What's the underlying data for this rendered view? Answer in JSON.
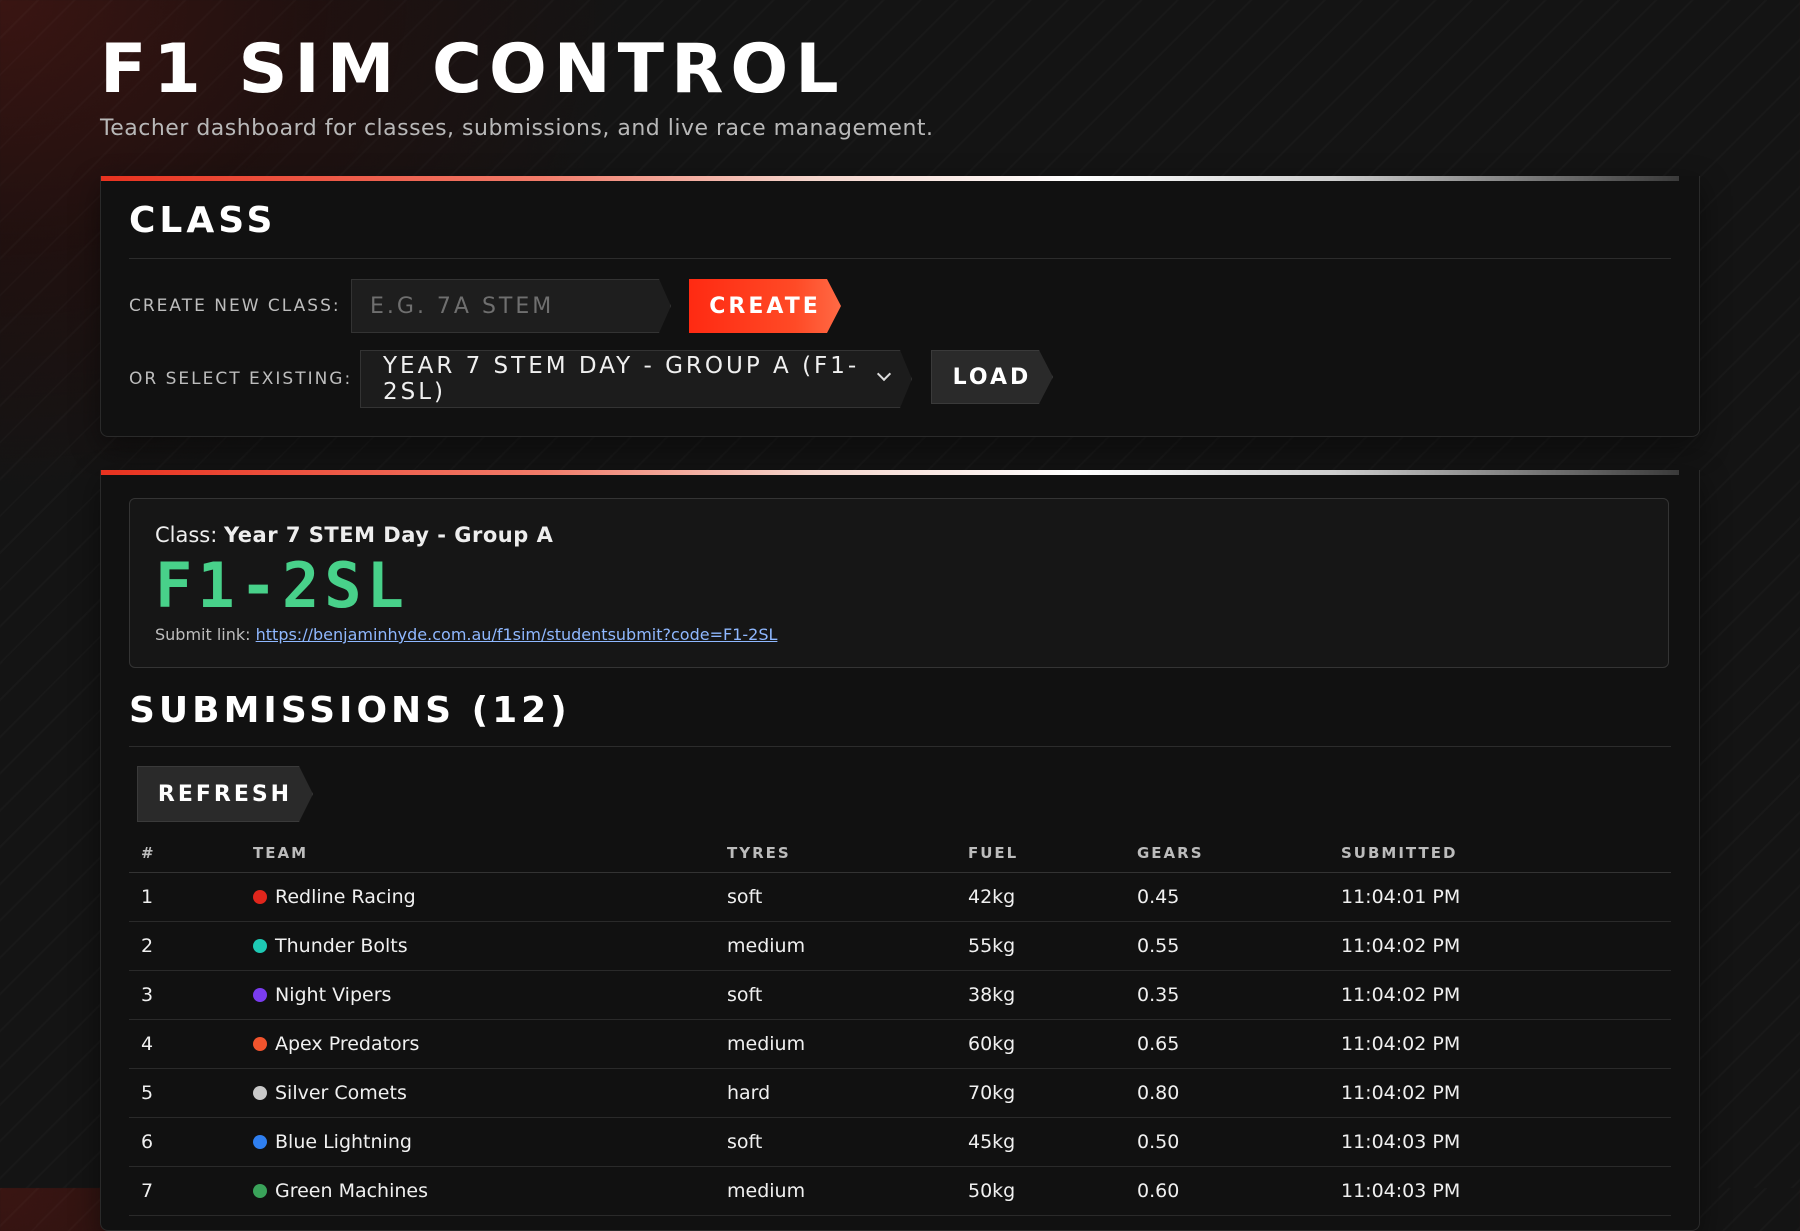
{
  "header": {
    "title": "F1 SIM CONTROL",
    "subtitle": "Teacher dashboard for classes, submissions, and live race management."
  },
  "class_panel": {
    "heading": "CLASS",
    "create_label": "CREATE NEW CLASS:",
    "create_placeholder": "E.G. 7A STEM",
    "create_button": "CREATE",
    "select_label": "OR SELECT EXISTING:",
    "selected_option": "YEAR 7 STEM DAY - GROUP A (F1-2SL)",
    "load_button": "LOAD"
  },
  "class_info": {
    "class_prefix": "Class:",
    "class_name": "Year 7 STEM Day - Group A",
    "code": "F1-2SL",
    "submit_prefix": "Submit link:",
    "submit_url": "https://benjaminhyde.com.au/f1sim/studentsubmit?code=F1-2SL"
  },
  "submissions": {
    "heading": "SUBMISSIONS (12)",
    "refresh_button": "REFRESH",
    "columns": [
      "#",
      "TEAM",
      "TYRES",
      "FUEL",
      "GEARS",
      "SUBMITTED"
    ],
    "rows": [
      {
        "num": "1",
        "team": "Redline Racing",
        "color": "#e0261c",
        "tyres": "soft",
        "fuel": "42kg",
        "gears": "0.45",
        "submitted": "11:04:01 PM"
      },
      {
        "num": "2",
        "team": "Thunder Bolts",
        "color": "#1ec9b4",
        "tyres": "medium",
        "fuel": "55kg",
        "gears": "0.55",
        "submitted": "11:04:02 PM"
      },
      {
        "num": "3",
        "team": "Night Vipers",
        "color": "#7a3cf0",
        "tyres": "soft",
        "fuel": "38kg",
        "gears": "0.35",
        "submitted": "11:04:02 PM"
      },
      {
        "num": "4",
        "team": "Apex Predators",
        "color": "#f2542d",
        "tyres": "medium",
        "fuel": "60kg",
        "gears": "0.65",
        "submitted": "11:04:02 PM"
      },
      {
        "num": "5",
        "team": "Silver Comets",
        "color": "#c9c9c9",
        "tyres": "hard",
        "fuel": "70kg",
        "gears": "0.80",
        "submitted": "11:04:02 PM"
      },
      {
        "num": "6",
        "team": "Blue Lightning",
        "color": "#2f7ff0",
        "tyres": "soft",
        "fuel": "45kg",
        "gears": "0.50",
        "submitted": "11:04:03 PM"
      },
      {
        "num": "7",
        "team": "Green Machines",
        "color": "#3aa35a",
        "tyres": "medium",
        "fuel": "50kg",
        "gears": "0.60",
        "submitted": "11:04:03 PM"
      }
    ]
  }
}
